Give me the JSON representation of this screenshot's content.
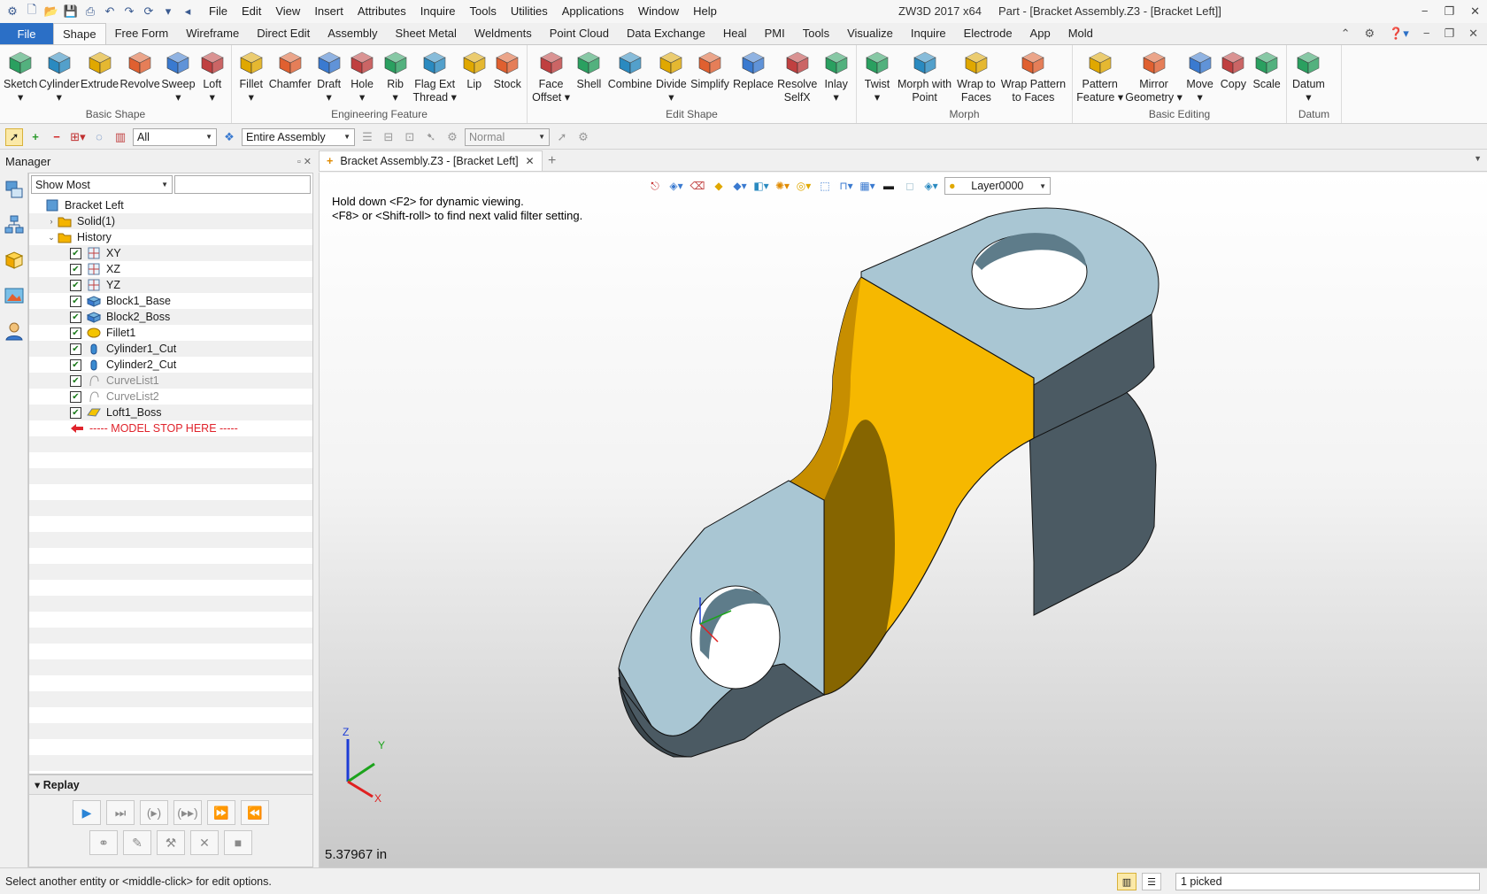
{
  "title_bar": {
    "app_name": "ZW3D 2017  x64",
    "document": "Part - [Bracket Assembly.Z3 - [Bracket Left]]",
    "menu": [
      "File",
      "Edit",
      "View",
      "Insert",
      "Attributes",
      "Inquire",
      "Tools",
      "Utilities",
      "Applications",
      "Window",
      "Help"
    ],
    "window_controls": [
      "−",
      "❐",
      "✕"
    ]
  },
  "ribbon_tabs": {
    "file": "File",
    "tabs": [
      "Shape",
      "Free Form",
      "Wireframe",
      "Direct Edit",
      "Assembly",
      "Sheet Metal",
      "Weldments",
      "Point Cloud",
      "Data Exchange",
      "Heal",
      "PMI",
      "Tools",
      "Visualize",
      "Inquire",
      "Electrode",
      "App",
      "Mold"
    ],
    "active": "Shape"
  },
  "ribbon": {
    "basic_shape": {
      "label": "Basic Shape",
      "tools": [
        {
          "label": "Sketch",
          "drop": "▾"
        },
        {
          "label": "Cylinder",
          "drop": "▾"
        },
        {
          "label": "Extrude",
          "drop": ""
        },
        {
          "label": "Revolve",
          "drop": ""
        },
        {
          "label": "Sweep",
          "drop": "▾"
        },
        {
          "label": "Loft",
          "drop": "▾"
        }
      ]
    },
    "engineering_feature": {
      "label": "Engineering Feature",
      "tools": [
        {
          "label": "Fillet",
          "drop": "▾"
        },
        {
          "label": "Chamfer",
          "drop": ""
        },
        {
          "label": "Draft",
          "drop": "▾"
        },
        {
          "label": "Hole",
          "drop": "▾"
        },
        {
          "label": "Rib",
          "drop": "▾"
        },
        {
          "label": "Flag Ext",
          "drop": "Thread ▾"
        },
        {
          "label": "Lip",
          "drop": ""
        },
        {
          "label": "Stock",
          "drop": ""
        }
      ]
    },
    "edit_shape": {
      "label": "Edit Shape",
      "tools": [
        {
          "label": "Face",
          "drop": "Offset ▾"
        },
        {
          "label": "Shell",
          "drop": ""
        },
        {
          "label": "Combine",
          "drop": ""
        },
        {
          "label": "Divide",
          "drop": "▾"
        },
        {
          "label": "Simplify",
          "drop": ""
        },
        {
          "label": "Replace",
          "drop": ""
        },
        {
          "label": "Resolve",
          "drop": "SelfX"
        },
        {
          "label": "Inlay",
          "drop": "▾"
        }
      ]
    },
    "morph": {
      "label": "Morph",
      "tools": [
        {
          "label": "Twist",
          "drop": "▾"
        },
        {
          "label": "Morph with",
          "drop": "Point"
        },
        {
          "label": "Wrap to",
          "drop": "Faces"
        },
        {
          "label": "Wrap Pattern",
          "drop": "to Faces"
        }
      ]
    },
    "basic_editing": {
      "label": "Basic Editing",
      "tools": [
        {
          "label": "Pattern",
          "drop": "Feature ▾"
        },
        {
          "label": "Mirror",
          "drop": "Geometry ▾"
        },
        {
          "label": "Move",
          "drop": "▾"
        },
        {
          "label": "Copy",
          "drop": ""
        },
        {
          "label": "Scale",
          "drop": ""
        }
      ]
    },
    "datum": {
      "label": "Datum",
      "tools": [
        {
          "label": "Datum",
          "drop": "▾"
        }
      ]
    }
  },
  "filter_bar": {
    "filter": "All",
    "scope": "Entire Assembly",
    "mode": "Normal"
  },
  "manager": {
    "title": "Manager",
    "pin": "▫ ✕",
    "filter_combo": "Show Most",
    "tree": [
      {
        "label": "Bracket Left",
        "twist": "",
        "check": false,
        "indent": 0,
        "style": "",
        "icon": "part-icon"
      },
      {
        "label": "Solid(1)",
        "twist": "›",
        "check": false,
        "indent": 1,
        "style": "",
        "icon": "folder-icon"
      },
      {
        "label": "History",
        "twist": "⌄",
        "check": false,
        "indent": 1,
        "style": "",
        "icon": "folder-icon"
      },
      {
        "label": "XY",
        "twist": "",
        "check": true,
        "indent": 2,
        "style": "",
        "icon": "plane-icon"
      },
      {
        "label": "XZ",
        "twist": "",
        "check": true,
        "indent": 2,
        "style": "",
        "icon": "plane-icon"
      },
      {
        "label": "YZ",
        "twist": "",
        "check": true,
        "indent": 2,
        "style": "",
        "icon": "plane-icon"
      },
      {
        "label": "Block1_Base",
        "twist": "",
        "check": true,
        "indent": 2,
        "style": "",
        "icon": "block-icon"
      },
      {
        "label": "Block2_Boss",
        "twist": "",
        "check": true,
        "indent": 2,
        "style": "",
        "icon": "block-icon"
      },
      {
        "label": "Fillet1",
        "twist": "",
        "check": true,
        "indent": 2,
        "style": "",
        "icon": "fillet-icon"
      },
      {
        "label": "Cylinder1_Cut",
        "twist": "",
        "check": true,
        "indent": 2,
        "style": "",
        "icon": "cylinder-icon"
      },
      {
        "label": "Cylinder2_Cut",
        "twist": "",
        "check": true,
        "indent": 2,
        "style": "",
        "icon": "cylinder-icon"
      },
      {
        "label": "CurveList1",
        "twist": "",
        "check": true,
        "indent": 2,
        "style": "dim",
        "icon": "curve-icon"
      },
      {
        "label": "CurveList2",
        "twist": "",
        "check": true,
        "indent": 2,
        "style": "dim",
        "icon": "curve-icon"
      },
      {
        "label": "Loft1_Boss",
        "twist": "",
        "check": true,
        "indent": 2,
        "style": "",
        "icon": "loft-icon"
      },
      {
        "label": "----- MODEL STOP HERE -----",
        "twist": "",
        "check": false,
        "indent": 2,
        "style": "stop",
        "icon": "arrow-left-icon"
      }
    ]
  },
  "replay": {
    "title": "Replay",
    "buttons_row1": [
      {
        "name": "play-button",
        "glyph": "▶"
      },
      {
        "name": "step-button",
        "glyph": "⏭"
      },
      {
        "name": "step-into-button",
        "glyph": "(▸)"
      },
      {
        "name": "step-over-button",
        "glyph": "(▸▸)"
      },
      {
        "name": "fast-forward-button",
        "glyph": "⏩"
      },
      {
        "name": "rewind-button",
        "glyph": "⏪"
      }
    ],
    "buttons_row2": [
      {
        "name": "link-button",
        "glyph": "⚭"
      },
      {
        "name": "edit-button",
        "glyph": "✎"
      },
      {
        "name": "run-button",
        "glyph": "⚒"
      },
      {
        "name": "delete-button",
        "glyph": "✕"
      },
      {
        "name": "stop-button",
        "glyph": "■"
      }
    ]
  },
  "document_tab": {
    "label": "Bracket Assembly.Z3 - [Bracket Left]",
    "close": "✕",
    "new": "+"
  },
  "viewport": {
    "layer": "Layer0000",
    "hint_line1": "Hold down <F2> for dynamic viewing.",
    "hint_line2": "<F8> or <Shift-roll> to find next valid filter setting.",
    "measure": "5.37967 in",
    "triad": {
      "x": "X",
      "y": "Y",
      "z": "Z"
    },
    "colors": {
      "selected_face": "#f6b800",
      "part_face": "#a9c6d3",
      "part_side": "#4b5a63",
      "x_axis": "#e02020",
      "y_axis": "#1ca31c",
      "z_axis": "#1c3cd6"
    }
  },
  "status_bar": {
    "prompt": "Select another entity or <middle-click> for edit options.",
    "picked": "1 picked"
  }
}
